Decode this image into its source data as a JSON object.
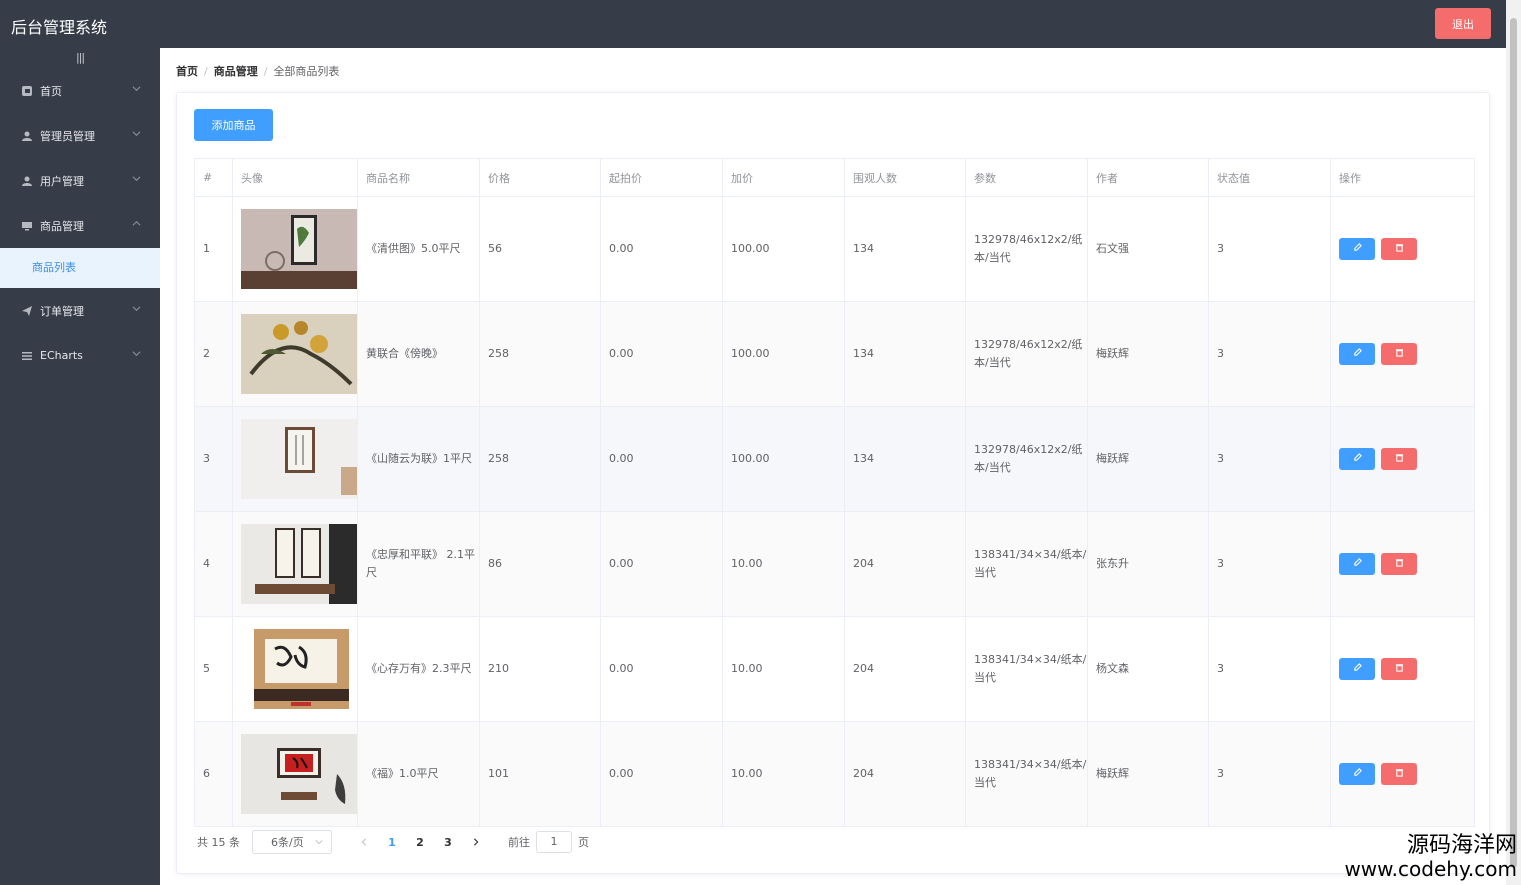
{
  "header": {
    "title": "后台管理系统",
    "logout_label": "退出"
  },
  "sidebar": {
    "toggle": "|||",
    "items": [
      {
        "label": "首页",
        "icon": "home-icon"
      },
      {
        "label": "管理员管理",
        "icon": "user-icon"
      },
      {
        "label": "用户管理",
        "icon": "user-icon"
      },
      {
        "label": "商品管理",
        "icon": "monitor-icon",
        "expanded": true,
        "children": [
          {
            "label": "商品列表",
            "active": true
          }
        ]
      },
      {
        "label": "订单管理",
        "icon": "send-icon"
      },
      {
        "label": "ECharts",
        "icon": "menu-icon"
      }
    ]
  },
  "breadcrumb": [
    "首页",
    "商品管理",
    "全部商品列表"
  ],
  "toolbar": {
    "add_label": "添加商品"
  },
  "table": {
    "columns": [
      "#",
      "头像",
      "商品名称",
      "价格",
      "起拍价",
      "加价",
      "围观人数",
      "参数",
      "作者",
      "状态值",
      "操作"
    ],
    "rows": [
      {
        "idx": "1",
        "name": "《清供图》5.0平尺",
        "price": "56",
        "start": "0.00",
        "inc": "100.00",
        "viewers": "134",
        "params": "132978/46x12x2/纸本/当代",
        "author": "石文强",
        "status": "3"
      },
      {
        "idx": "2",
        "name": "黄联合《傍晚》",
        "price": "258",
        "start": "0.00",
        "inc": "100.00",
        "viewers": "134",
        "params": "132978/46x12x2/纸本/当代",
        "author": "梅跃辉",
        "status": "3"
      },
      {
        "idx": "3",
        "name": "《山随云为联》1平尺",
        "price": "258",
        "start": "0.00",
        "inc": "100.00",
        "viewers": "134",
        "params": "132978/46x12x2/纸本/当代",
        "author": "梅跃辉",
        "status": "3"
      },
      {
        "idx": "4",
        "name": "《忠厚和平联》 2.1平尺",
        "price": "86",
        "start": "0.00",
        "inc": "10.00",
        "viewers": "204",
        "params": "138341/34×34/纸本/当代",
        "author": "张东升",
        "status": "3"
      },
      {
        "idx": "5",
        "name": "《心存万有》2.3平尺",
        "price": "210",
        "start": "0.00",
        "inc": "10.00",
        "viewers": "204",
        "params": "138341/34×34/纸本/当代",
        "author": "杨文森",
        "status": "3"
      },
      {
        "idx": "6",
        "name": "《福》1.0平尺",
        "price": "101",
        "start": "0.00",
        "inc": "10.00",
        "viewers": "204",
        "params": "138341/34×34/纸本/当代",
        "author": "梅跃辉",
        "status": "3"
      }
    ]
  },
  "pagination": {
    "total": "共 15 条",
    "page_size": "6条/页",
    "pages": [
      "1",
      "2",
      "3"
    ],
    "current": "1",
    "goto_label": "前往",
    "goto_value": "1",
    "page_suffix": "页"
  },
  "watermark": {
    "line1": "源码海洋网",
    "line2": "www.codehy.com"
  },
  "colors": {
    "primary": "#409eff",
    "danger": "#f56c6c",
    "sidebar_bg": "#373d48",
    "active_sub": "#e9f3fd"
  }
}
